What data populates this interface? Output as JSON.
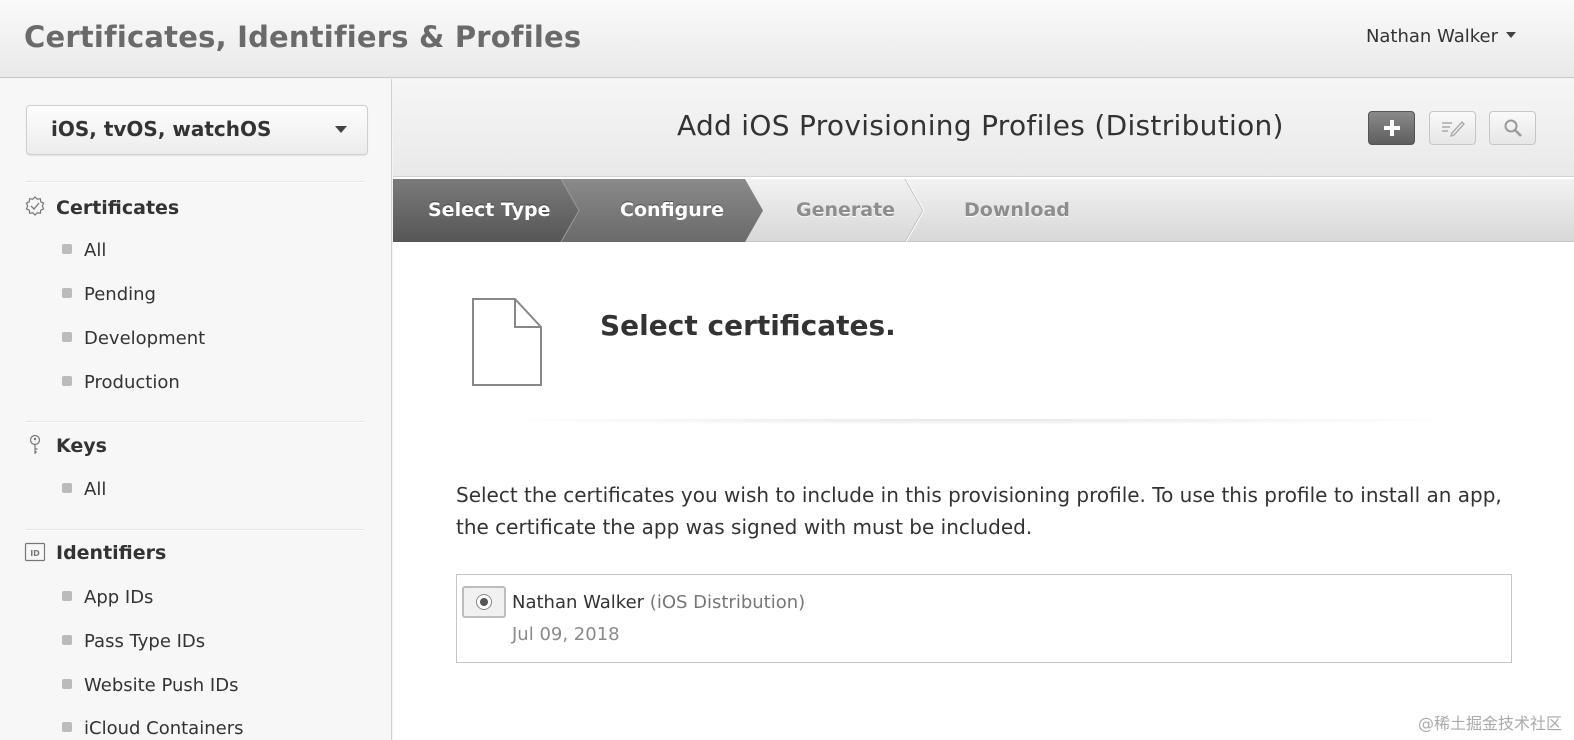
{
  "header": {
    "app_title": "Certificates, Identifiers & Profiles",
    "user_name": "Nathan Walker"
  },
  "sidebar": {
    "platform": "iOS, tvOS, watchOS",
    "sections": [
      {
        "title": "Certificates",
        "icon": "certificate-badge-icon",
        "items": [
          "All",
          "Pending",
          "Development",
          "Production"
        ]
      },
      {
        "title": "Keys",
        "icon": "key-icon",
        "items": [
          "All"
        ]
      },
      {
        "title": "Identifiers",
        "icon": "id-card-icon",
        "items": [
          "App IDs",
          "Pass Type IDs",
          "Website Push IDs",
          "iCloud Containers"
        ]
      }
    ]
  },
  "main": {
    "title": "Add iOS Provisioning Profiles (Distribution)",
    "tools": [
      "plus-icon",
      "edit-icon",
      "search-icon"
    ],
    "steps": [
      {
        "label": "Select Type",
        "state": "complete"
      },
      {
        "label": "Configure",
        "state": "active"
      },
      {
        "label": "Generate",
        "state": "pending"
      },
      {
        "label": "Download",
        "state": "pending"
      }
    ],
    "heading": "Select certificates.",
    "description": "Select the certificates you wish to include in this provisioning profile. To use this profile to install an app, the certificate the app was signed with must be included.",
    "certificate": {
      "name": "Nathan Walker",
      "type": "(iOS Distribution)",
      "date": "Jul 09, 2018",
      "selected": true
    }
  },
  "watermark": "@稀土掘金技术社区",
  "colors": {
    "step_active_dark": "#5a5a5a",
    "step_active": "#707070",
    "step_inactive_text": "#8d8d8d"
  }
}
